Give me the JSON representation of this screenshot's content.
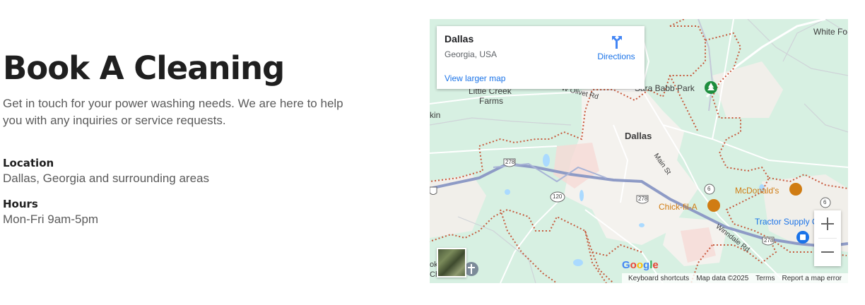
{
  "hero": {
    "title": "Book A Cleaning",
    "intro": "Get in touch for your power washing needs. We are here to help you with any inquiries or service requests."
  },
  "location": {
    "label": "Location",
    "value": "Dallas, Georgia and surrounding areas"
  },
  "hours": {
    "label": "Hours",
    "value": "Mon-Fri 9am-5pm"
  },
  "map": {
    "info_card": {
      "title": "Dallas",
      "subtitle": "Georgia, USA",
      "link": "View larger map",
      "directions_label": "Directions",
      "directions_icon": "directions-icon"
    },
    "labels": {
      "white_fo": "White Fo",
      "sara_babb_park": "Sara Babb Park",
      "little_creek_farms_1": "Little Creek",
      "little_creek_farms_2": "Farms",
      "olivet_rd": "W Olivet Rd",
      "kin": "kin",
      "dallas": "Dallas",
      "main_st": "Main St",
      "mcdonalds": "McDonald's",
      "chick_fil_a": "Chick-fil-A",
      "tractor_supply": "Tractor Supply C",
      "windale_rd": "Winndale Rd",
      "church": "Church",
      "ok": "ok",
      "route_278_a": "278",
      "route_278_b": "278",
      "route_278_c": "278",
      "route_120": "120",
      "route_6_a": "6",
      "route_6_b": "6"
    },
    "google_logo": "Google",
    "attribution": {
      "keyboard": "Keyboard shortcuts",
      "map_data": "Map data ©2025",
      "terms": "Terms",
      "report": "Report a map error"
    },
    "colors": {
      "land": "#d7f0e2",
      "urban": "#f4f2ee",
      "highway": "#8e9bc6",
      "boundary": "#c4492a",
      "water": "#aadaff",
      "poi_orange": "#d07c13",
      "poi_blue": "#1a73e8",
      "park_green": "#1e8e3e"
    }
  }
}
